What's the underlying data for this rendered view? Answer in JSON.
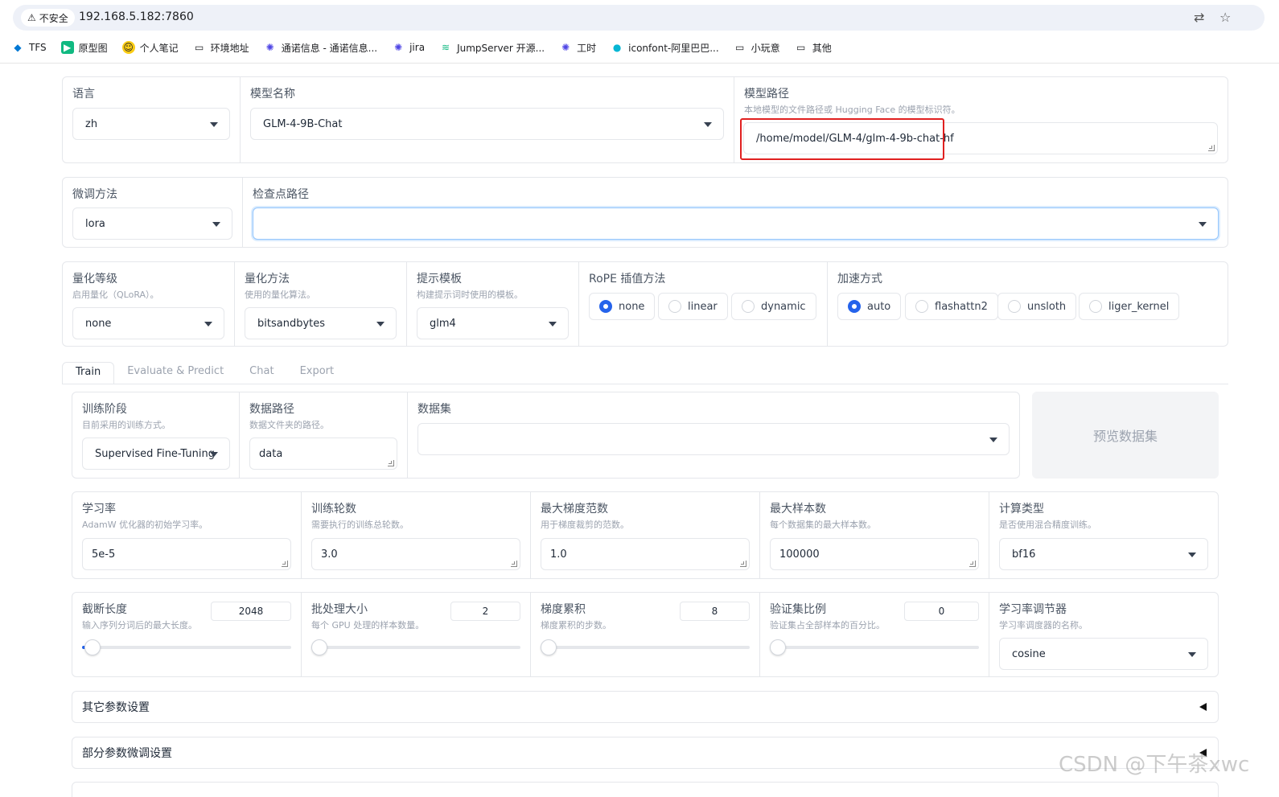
{
  "browser": {
    "security_label": "不安全",
    "url": "192.168.5.182:7860",
    "bookmarks": [
      "TFS",
      "原型图",
      "个人笔记",
      "环境地址",
      "通诺信息 - 通诺信息...",
      "jira",
      "JumpServer 开源...",
      "工时",
      "iconfont-阿里巴巴...",
      "小玩意",
      "其他"
    ]
  },
  "top": {
    "lang_label": "语言",
    "lang_value": "zh",
    "model_name_label": "模型名称",
    "model_name_value": "GLM-4-9B-Chat",
    "model_path_label": "模型路径",
    "model_path_desc": "本地模型的文件路径或 Hugging Face 的模型标识符。",
    "model_path_value": "/home/model/GLM-4/glm-4-9b-chat-hf"
  },
  "finetune": {
    "method_label": "微调方法",
    "method_value": "lora",
    "checkpoint_label": "检查点路径",
    "checkpoint_value": ""
  },
  "quant": {
    "level_label": "量化等级",
    "level_desc": "启用量化（QLoRA）。",
    "level_value": "none",
    "method_label": "量化方法",
    "method_desc": "使用的量化算法。",
    "method_value": "bitsandbytes",
    "template_label": "提示模板",
    "template_desc": "构建提示词时使用的模板。",
    "template_value": "glm4",
    "rope_label": "RoPE 插值方法",
    "rope_options": [
      "none",
      "linear",
      "dynamic"
    ],
    "rope_selected": "none",
    "accel_label": "加速方式",
    "accel_options": [
      "auto",
      "flashattn2",
      "unsloth",
      "liger_kernel"
    ],
    "accel_selected": "auto"
  },
  "tabs": [
    "Train",
    "Evaluate & Predict",
    "Chat",
    "Export"
  ],
  "train": {
    "stage_label": "训练阶段",
    "stage_desc": "目前采用的训练方式。",
    "stage_value": "Supervised Fine-Tuning",
    "data_path_label": "数据路径",
    "data_path_desc": "数据文件夹的路径。",
    "data_path_value": "data",
    "dataset_label": "数据集",
    "dataset_value": "",
    "preview_button": "预览数据集",
    "lr_label": "学习率",
    "lr_desc": "AdamW 优化器的初始学习率。",
    "lr_value": "5e-5",
    "epochs_label": "训练轮数",
    "epochs_desc": "需要执行的训练总轮数。",
    "epochs_value": "3.0",
    "grad_norm_label": "最大梯度范数",
    "grad_norm_desc": "用于梯度裁剪的范数。",
    "grad_norm_value": "1.0",
    "max_samples_label": "最大样本数",
    "max_samples_desc": "每个数据集的最大样本数。",
    "max_samples_value": "100000",
    "compute_label": "计算类型",
    "compute_desc": "是否使用混合精度训练。",
    "compute_value": "bf16",
    "cutoff_label": "截断长度",
    "cutoff_desc": "输入序列分词后的最大长度。",
    "cutoff_value": "2048",
    "batch_label": "批处理大小",
    "batch_desc": "每个 GPU 处理的样本数量。",
    "batch_value": "2",
    "grad_acc_label": "梯度累积",
    "grad_acc_desc": "梯度累积的步数。",
    "grad_acc_value": "8",
    "val_label": "验证集比例",
    "val_desc": "验证集占全部样本的百分比。",
    "val_value": "0",
    "scheduler_label": "学习率调节器",
    "scheduler_desc": "学习率调度器的名称。",
    "scheduler_value": "cosine",
    "other_settings": "其它参数设置",
    "partial_settings": "部分参数微调设置"
  },
  "watermark": "CSDN @下午茶xwc",
  "colors": {
    "accent": "#2563eb",
    "highlight": "#e02020"
  }
}
